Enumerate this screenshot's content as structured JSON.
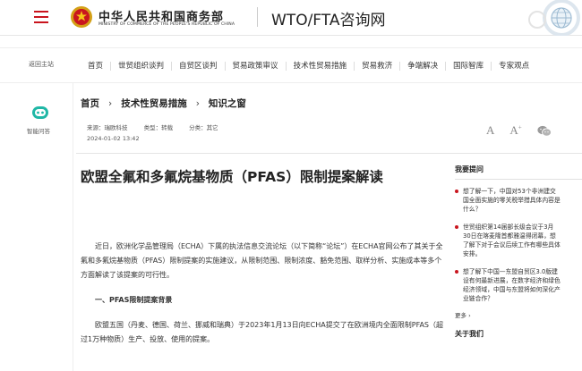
{
  "header": {
    "ministry_cn": "中华人民共和国商务部",
    "ministry_en": "MINISTRY OF COMMERCE OF THE PEOPLE'S REPUBLIC OF CHINA",
    "site_title": "WTO/FTA咨询网",
    "brand_color": "#c9151e"
  },
  "nav": {
    "back_home": "返回主站",
    "items": [
      "首页",
      "世贸组织谈判",
      "自贸区谈判",
      "贸易政策审议",
      "技术性贸易措施",
      "贸易救济",
      "争端解决",
      "国际智库",
      "专家观点"
    ]
  },
  "sidebar": {
    "assistant_label": "智能问答"
  },
  "breadcrumb": [
    "首页",
    "技术性贸易措施",
    "知识之窗"
  ],
  "meta": {
    "source": "来源：瑞欧科技",
    "type": "类型：转载",
    "category": "分类：其它",
    "date": "2024-01-02 13:42"
  },
  "tools": {
    "font_small": "A",
    "font_large": "A",
    "font_large_sup": "+"
  },
  "article": {
    "title": "欧盟全氟和多氟烷基物质（PFAS）限制提案解读",
    "para1": "近日，欧洲化学品管理局（ECHA）下属的执法信息交流论坛（以下简称“论坛”）在ECHA官网公布了其关于全氟和多氟烷基物质（PFAS）限制提案的实施建议，从限制范围、限制浓度、豁免范围、取样分析、实施成本等多个方面解读了该提案的可行性。",
    "section1": "一、PFAS限制提案背景",
    "para2": "欧盟五国（丹麦、德国、荷兰、挪威和瑞典）于2023年1月13日向ECHA提交了在欧洲境内全面限制PFAS（超过1万种物质）生产、投放、使用的提案。"
  },
  "right": {
    "faq_head": "我要提问",
    "faq": [
      "想了解一下，中国对53个非洲建交国全面实施的零关税举措具体内容是什么？",
      "世贸组织第14届部长级会议于3月30日在喀麦隆首都雅温得闭幕，想了解下对于会议后续工作有哪些具体安排。",
      "想了解下中国—东盟自贸区3.0版建设有何最新进展，在数字经济和绿色经济领域，中国与东盟将如何深化产业链合作？"
    ],
    "more": "更多 ›",
    "about_head": "关于我们"
  }
}
